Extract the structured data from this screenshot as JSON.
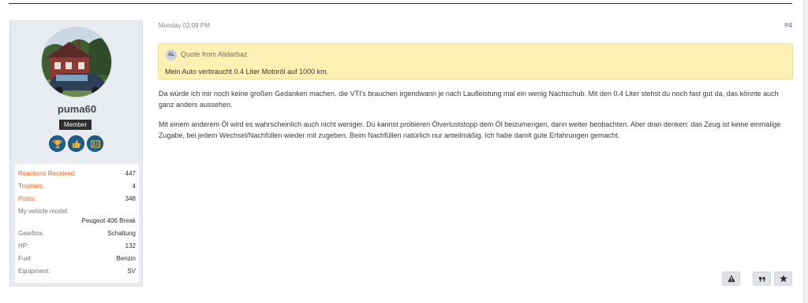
{
  "post": {
    "date": "Monday 02:09 PM",
    "number": "#4",
    "quote": {
      "author_initials": "AL",
      "header": "Quote from Alidarbaz",
      "text": "Mein Auto verbraucht 0.4 Liter Motoröl auf 1000 km."
    },
    "paragraphs": [
      "Da würde ich mir noch keine großen Gedanken machen. die VTI's brauchen irgendwann je nach Laufleistung mal ein wenig Nachschub. Mit den 0.4 Liter stehst du noch fast gut da, das könnte auch ganz anders aussehen.",
      "Mit einem anderem Öl wird es wahrscheinlich auch nicht weniger. Du kannst probieren Ölverluststopp dem Öl beizumengen, dann weiter beobachten. Aber dran denken: das Zeug ist keine einmalige Zugabe, bei jedem Wechsel/Nachfüllen wieder mit zugeben. Beim Nachfüllen natürlich nur anteilmäßig. Ich habe damit gute Erfahrungen gemacht."
    ],
    "actions": [
      "report-icon",
      "quote-icon",
      "bookmark-icon"
    ]
  },
  "user": {
    "name": "puma60",
    "rank": "Member",
    "badges": [
      "trophy-icon",
      "thumbs-up-icon",
      "id-card-icon"
    ],
    "stats": [
      {
        "label": "Reactions Received:",
        "value": "447"
      },
      {
        "label": "Trophies:",
        "value": "4"
      },
      {
        "label": "Posts:",
        "value": "348"
      }
    ],
    "vehicle_label": "My vehicle model:",
    "vehicle_value": "Peugeot 406 Break",
    "details": [
      {
        "label": "Gearbox:",
        "value": "Schaltung"
      },
      {
        "label": "HP:",
        "value": "132"
      },
      {
        "label": "Fuel:",
        "value": "Benzin"
      },
      {
        "label": "Equipment:",
        "value": "SV"
      }
    ]
  },
  "colors": {
    "accent_orange": "#e2632a",
    "badge_blue": "#1e5f8a",
    "quote_bg": "#fdf0b3",
    "sidebar_bg": "#e8ebef"
  }
}
